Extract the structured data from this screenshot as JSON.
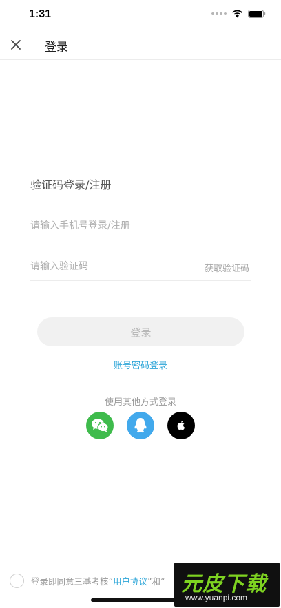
{
  "status": {
    "time": "1:31"
  },
  "nav": {
    "title": "登录",
    "close_icon": "close-icon"
  },
  "login": {
    "section_title": "验证码登录/注册",
    "phone_placeholder": "请输入手机号登录/注册",
    "code_placeholder": "请输入验证码",
    "get_code_label": "获取验证码",
    "login_button": "登录",
    "password_login_link": "账号密码登录"
  },
  "other_login": {
    "label": "使用其他方式登录",
    "options": [
      {
        "icon": "wechat-icon",
        "color": "#3fbb4c"
      },
      {
        "icon": "qq-icon",
        "color": "#42a9ec"
      },
      {
        "icon": "apple-icon",
        "color": "#000000"
      }
    ]
  },
  "agreement": {
    "prefix": "登录即同意三基考核“",
    "user_agreement": "用户协议",
    "middle": "”和“"
  },
  "watermark": {
    "title": "元皮下载",
    "url": "www.yuanpi.com"
  },
  "colors": {
    "accent": "#2ea6d8",
    "button_bg": "#f1f1f1"
  }
}
